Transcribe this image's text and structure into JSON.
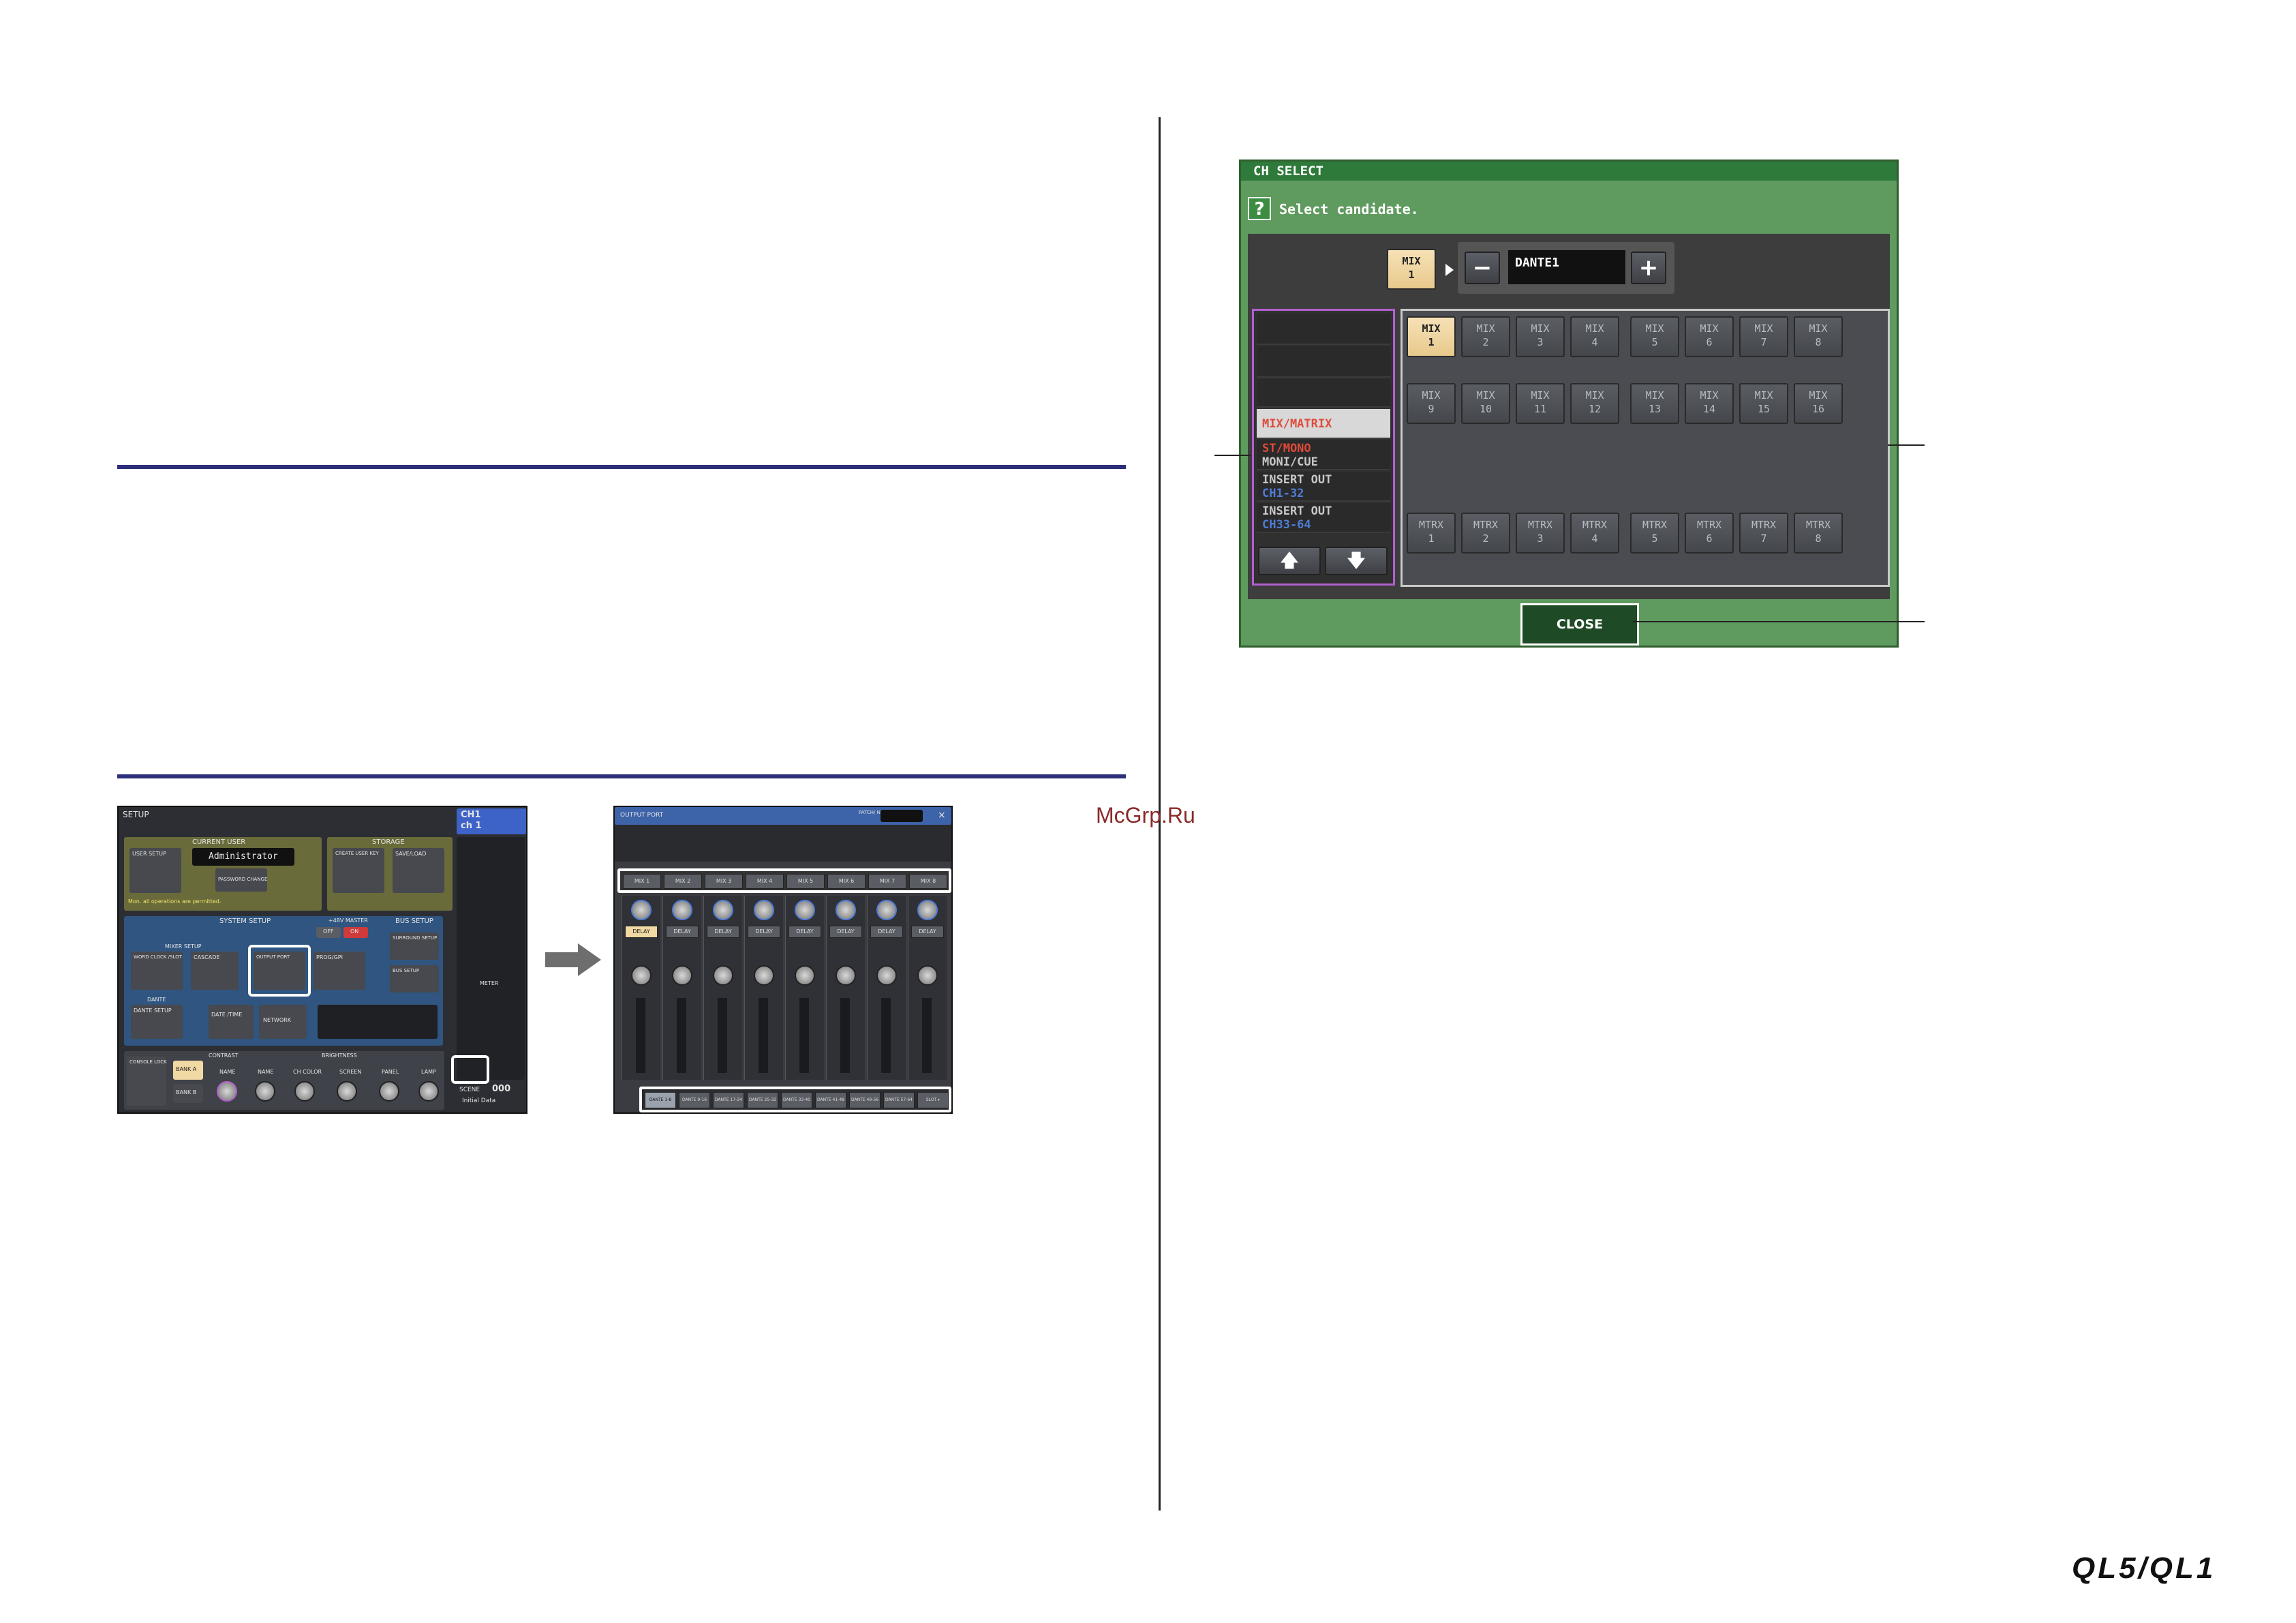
{
  "watermark": "McGrp.Ru",
  "brand_logo": "QL5/QL1",
  "ch_select": {
    "title": "CH SELECT",
    "help_icon": "?",
    "prompt": "Select candidate.",
    "current": {
      "l1": "MIX",
      "l2": "1"
    },
    "minus": "−",
    "plus": "+",
    "dante_value": "DANTE1",
    "categories": [
      {
        "line1": "",
        "line2": ""
      },
      {
        "line1": "",
        "line2": ""
      },
      {
        "line1": "",
        "line2": ""
      },
      {
        "line1": "MIX/MATRIX",
        "line2": ""
      },
      {
        "line1": "ST/MONO",
        "line2": "MONI/CUE"
      },
      {
        "line1": "INSERT OUT",
        "line2": "CH1-32"
      },
      {
        "line1": "INSERT OUT",
        "line2": "CH33-64"
      }
    ],
    "up_label": "🡅",
    "down_label": "🡇",
    "buttons_row1": [
      {
        "l1": "MIX",
        "l2": "1"
      },
      {
        "l1": "MIX",
        "l2": "2"
      },
      {
        "l1": "MIX",
        "l2": "3"
      },
      {
        "l1": "MIX",
        "l2": "4"
      },
      {
        "l1": "MIX",
        "l2": "5"
      },
      {
        "l1": "MIX",
        "l2": "6"
      },
      {
        "l1": "MIX",
        "l2": "7"
      },
      {
        "l1": "MIX",
        "l2": "8"
      }
    ],
    "buttons_row2": [
      {
        "l1": "MIX",
        "l2": "9"
      },
      {
        "l1": "MIX",
        "l2": "10"
      },
      {
        "l1": "MIX",
        "l2": "11"
      },
      {
        "l1": "MIX",
        "l2": "12"
      },
      {
        "l1": "MIX",
        "l2": "13"
      },
      {
        "l1": "MIX",
        "l2": "14"
      },
      {
        "l1": "MIX",
        "l2": "15"
      },
      {
        "l1": "MIX",
        "l2": "16"
      }
    ],
    "buttons_row3": [
      {
        "l1": "MTRX",
        "l2": "1"
      },
      {
        "l1": "MTRX",
        "l2": "2"
      },
      {
        "l1": "MTRX",
        "l2": "3"
      },
      {
        "l1": "MTRX",
        "l2": "4"
      },
      {
        "l1": "MTRX",
        "l2": "5"
      },
      {
        "l1": "MTRX",
        "l2": "6"
      },
      {
        "l1": "MTRX",
        "l2": "7"
      },
      {
        "l1": "MTRX",
        "l2": "8"
      }
    ],
    "close_label": "CLOSE"
  },
  "setup_screen": {
    "title": "SETUP",
    "ch_badge_l1": "CH1",
    "ch_badge_l2": "ch 1",
    "current_user": "CURRENT USER",
    "storage": "STORAGE",
    "user_setup": "USER SETUP",
    "administrator": "Administrator",
    "password_change": "PASSWORD CHANGE",
    "create_user_key": "CREATE USER KEY",
    "save_load": "SAVE/LOAD",
    "permission_note": "Mon. all operations are permitted.",
    "system_setup": "SYSTEM SETUP",
    "bus_setup": "BUS SETUP",
    "plus48v_master": "+48V MASTER",
    "off": "OFF",
    "on": "ON",
    "mixer_setup": "MIXER SETUP",
    "word_clock": "WORD CLOCK /SLOT",
    "cascade": "CASCADE",
    "output_port": "OUTPUT PORT",
    "prog_gpi": "PROG/GPI",
    "surround_setup": "SURROUND SETUP",
    "bus_setup_btn": "BUS SETUP",
    "dante": "DANTE",
    "dante_setup": "DANTE SETUP",
    "date_time": "DATE /TIME",
    "network": "NETWORK",
    "console_lock": "CONSOLE LOCK",
    "contrast": "CONTRAST",
    "brightness": "BRIGHTNESS",
    "bank_a": "BANK A",
    "bank_b": "BANK B",
    "name": "NAME",
    "ch_color": "CH COLOR",
    "screen": "SCREEN",
    "panel": "PANEL",
    "lamp": "LAMP",
    "meter": "METER",
    "scene_label": "SCENE",
    "scene_num": "000",
    "scene_name": "Initial Data"
  },
  "output_port_screen": {
    "title": "OUTPUT PORT",
    "patch_label": "PATCH/ NAME",
    "close_x": "×",
    "heads": [
      "MIX 1",
      "MIX 2",
      "MIX 3",
      "MIX 4",
      "MIX 5",
      "MIX 6",
      "MIX 7",
      "MIX 8"
    ],
    "delay": "DELAY",
    "tabs": [
      "DANTE 1-8",
      "DANTE 9-16",
      "DANTE 17-24",
      "DANTE 25-32",
      "DANTE 33-40",
      "DANTE 41-48",
      "DANTE 49-56",
      "DANTE 57-64",
      "SLOT ▸"
    ]
  },
  "colors": {
    "rule": "#2d2f7a",
    "dialog_green": "#5f9a5f",
    "title_green": "#2e7a3a",
    "selected": "#f1d9a4",
    "category_outline": "#b35fd0",
    "category_red": "#e04a3a",
    "category_blue": "#4f7cd8"
  }
}
